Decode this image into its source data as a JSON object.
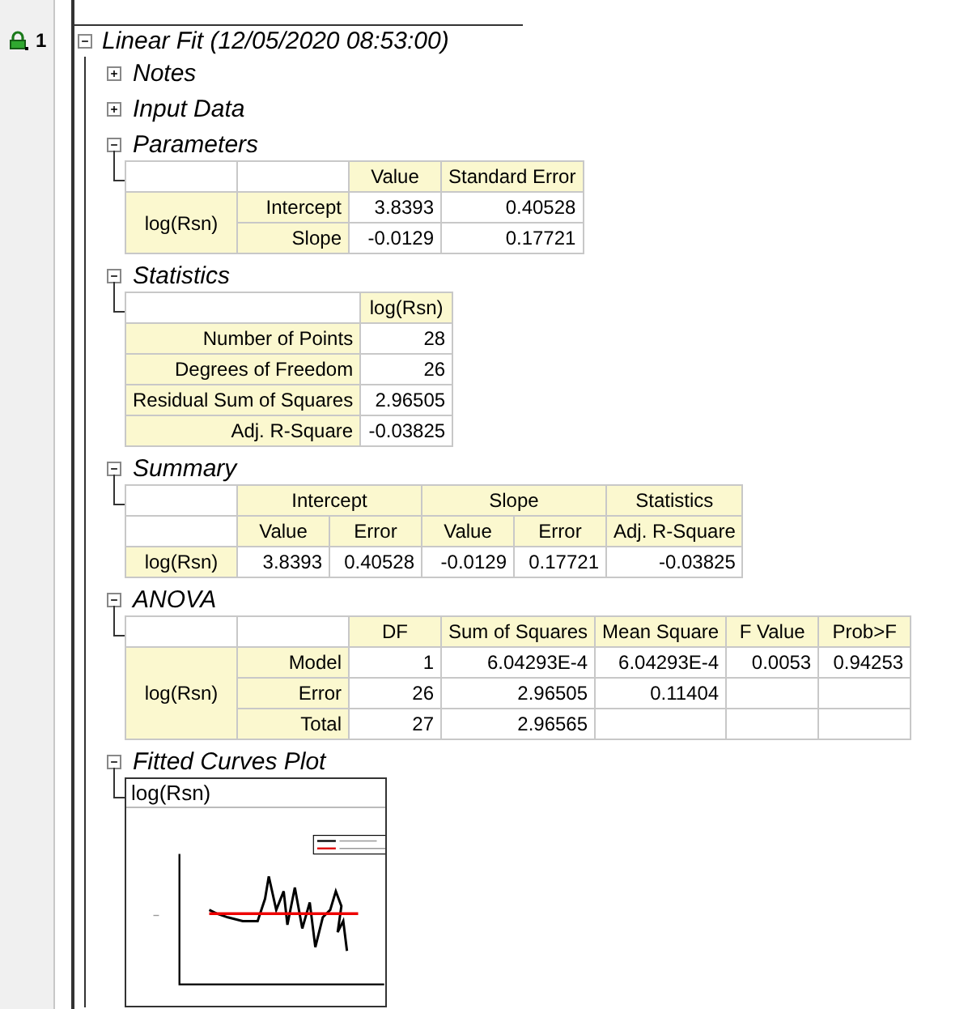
{
  "row_number": "1",
  "report": {
    "title": "Linear Fit (12/05/2020 08:53:00)",
    "expanded": true,
    "sections": [
      {
        "title": "Notes",
        "expanded": false
      },
      {
        "title": "Input Data",
        "expanded": false
      },
      {
        "kind": "grouped_table",
        "title": "Parameters",
        "expanded": true,
        "columns": [
          "Value",
          "Standard Error"
        ],
        "group": "log(Rsn)",
        "rows": [
          {
            "label": "Intercept",
            "values": [
              "3.8393",
              "0.40528"
            ]
          },
          {
            "label": "Slope",
            "values": [
              "-0.0129",
              "0.17721"
            ]
          }
        ]
      },
      {
        "kind": "stat_table",
        "title": "Statistics",
        "expanded": true,
        "column": "log(Rsn)",
        "rows": [
          {
            "label": "Number of Points",
            "value": "28"
          },
          {
            "label": "Degrees of Freedom",
            "value": "26"
          },
          {
            "label": "Residual Sum of Squares",
            "value": "2.96505"
          },
          {
            "label": "Adj. R-Square",
            "value": "-0.03825"
          }
        ]
      },
      {
        "kind": "summary_table",
        "title": "Summary",
        "expanded": true,
        "groups": [
          {
            "name": "Intercept",
            "columns": [
              "Value",
              "Error"
            ]
          },
          {
            "name": "Slope",
            "columns": [
              "Value",
              "Error"
            ]
          },
          {
            "name": "Statistics",
            "columns": [
              "Adj. R-Square"
            ]
          }
        ],
        "row": {
          "label": "log(Rsn)",
          "values": [
            "3.8393",
            "0.40528",
            "-0.0129",
            "0.17721",
            "-0.03825"
          ]
        }
      },
      {
        "kind": "grouped_table",
        "title": "ANOVA",
        "expanded": true,
        "columns": [
          "DF",
          "Sum of Squares",
          "Mean Square",
          "F Value",
          "Prob>F"
        ],
        "group": "log(Rsn)",
        "rows": [
          {
            "label": "Model",
            "values": [
              "1",
              "6.04293E-4",
              "6.04293E-4",
              "0.0053",
              "0.94253"
            ]
          },
          {
            "label": "Error",
            "values": [
              "26",
              "2.96505",
              "0.11404"
            ]
          },
          {
            "label": "Total",
            "values": [
              "27",
              "2.96565"
            ]
          }
        ]
      },
      {
        "kind": "plot",
        "title": "Fitted Curves Plot",
        "expanded": true,
        "plot_title": "log(Rsn)"
      }
    ]
  }
}
